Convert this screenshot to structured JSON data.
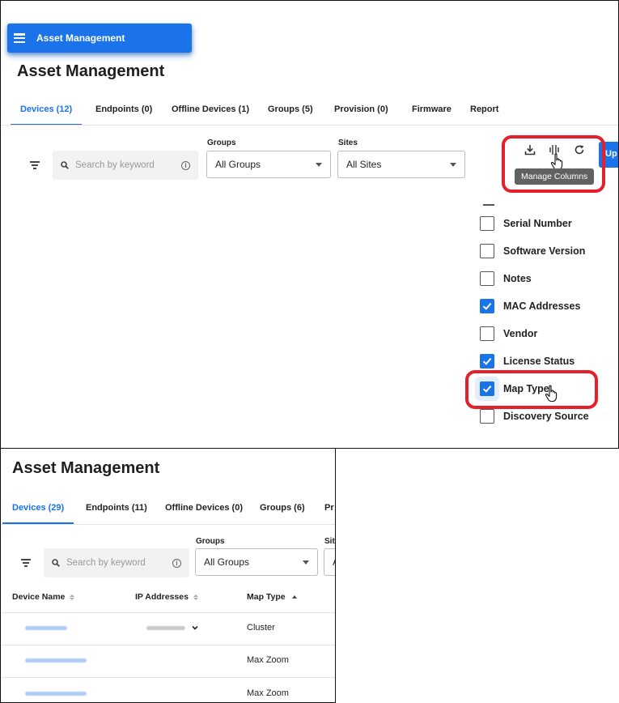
{
  "top": {
    "banner_label": "Asset Management",
    "title": "Asset Management",
    "tabs": [
      {
        "label": "Devices (12)",
        "active": true
      },
      {
        "label": "Endpoints (0)",
        "active": false
      },
      {
        "label": "Offline Devices (1)",
        "active": false
      },
      {
        "label": "Groups (5)",
        "active": false
      },
      {
        "label": "Provision (0)",
        "active": false
      },
      {
        "label": "Firmware",
        "active": false
      },
      {
        "label": "Report",
        "active": false
      }
    ],
    "search_placeholder": "Search by keyword",
    "groups_label": "Groups",
    "groups_value": "All Groups",
    "sites_label": "Sites",
    "sites_value": "All Sites",
    "toolbar": {
      "download_icon": "download-icon",
      "columns_icon": "manage-columns-icon",
      "refresh_icon": "refresh-icon",
      "tooltip": "Manage Columns",
      "cut_button_label": "Up"
    },
    "columns": [
      {
        "label": "Serial Number",
        "checked": false
      },
      {
        "label": "Software Version",
        "checked": false
      },
      {
        "label": "Notes",
        "checked": false
      },
      {
        "label": "MAC Addresses",
        "checked": true
      },
      {
        "label": "Vendor",
        "checked": false
      },
      {
        "label": "License Status",
        "checked": true
      },
      {
        "label": "Map Type",
        "checked": true
      },
      {
        "label": "Discovery Source",
        "checked": false
      }
    ],
    "highlight_color": "#e4202a",
    "accent_color": "#1a73e8"
  },
  "bottom": {
    "title": "Asset Management",
    "tabs": [
      {
        "label": "Devices (29)",
        "active": true
      },
      {
        "label": "Endpoints (11)",
        "active": false
      },
      {
        "label": "Offline Devices (0)",
        "active": false
      },
      {
        "label": "Groups (6)",
        "active": false
      },
      {
        "label": "Pr",
        "active": false
      }
    ],
    "search_placeholder": "Search by keyword",
    "groups_label": "Groups",
    "groups_value": "All Groups",
    "sites_label_cut": "Sit",
    "sites_value_cut": "A",
    "table": {
      "headers": [
        "Device Name",
        "IP Addresses",
        "Map Type"
      ],
      "rows": [
        {
          "map_type": "Cluster"
        },
        {
          "map_type": "Max Zoom"
        },
        {
          "map_type": "Max Zoom"
        }
      ]
    }
  }
}
